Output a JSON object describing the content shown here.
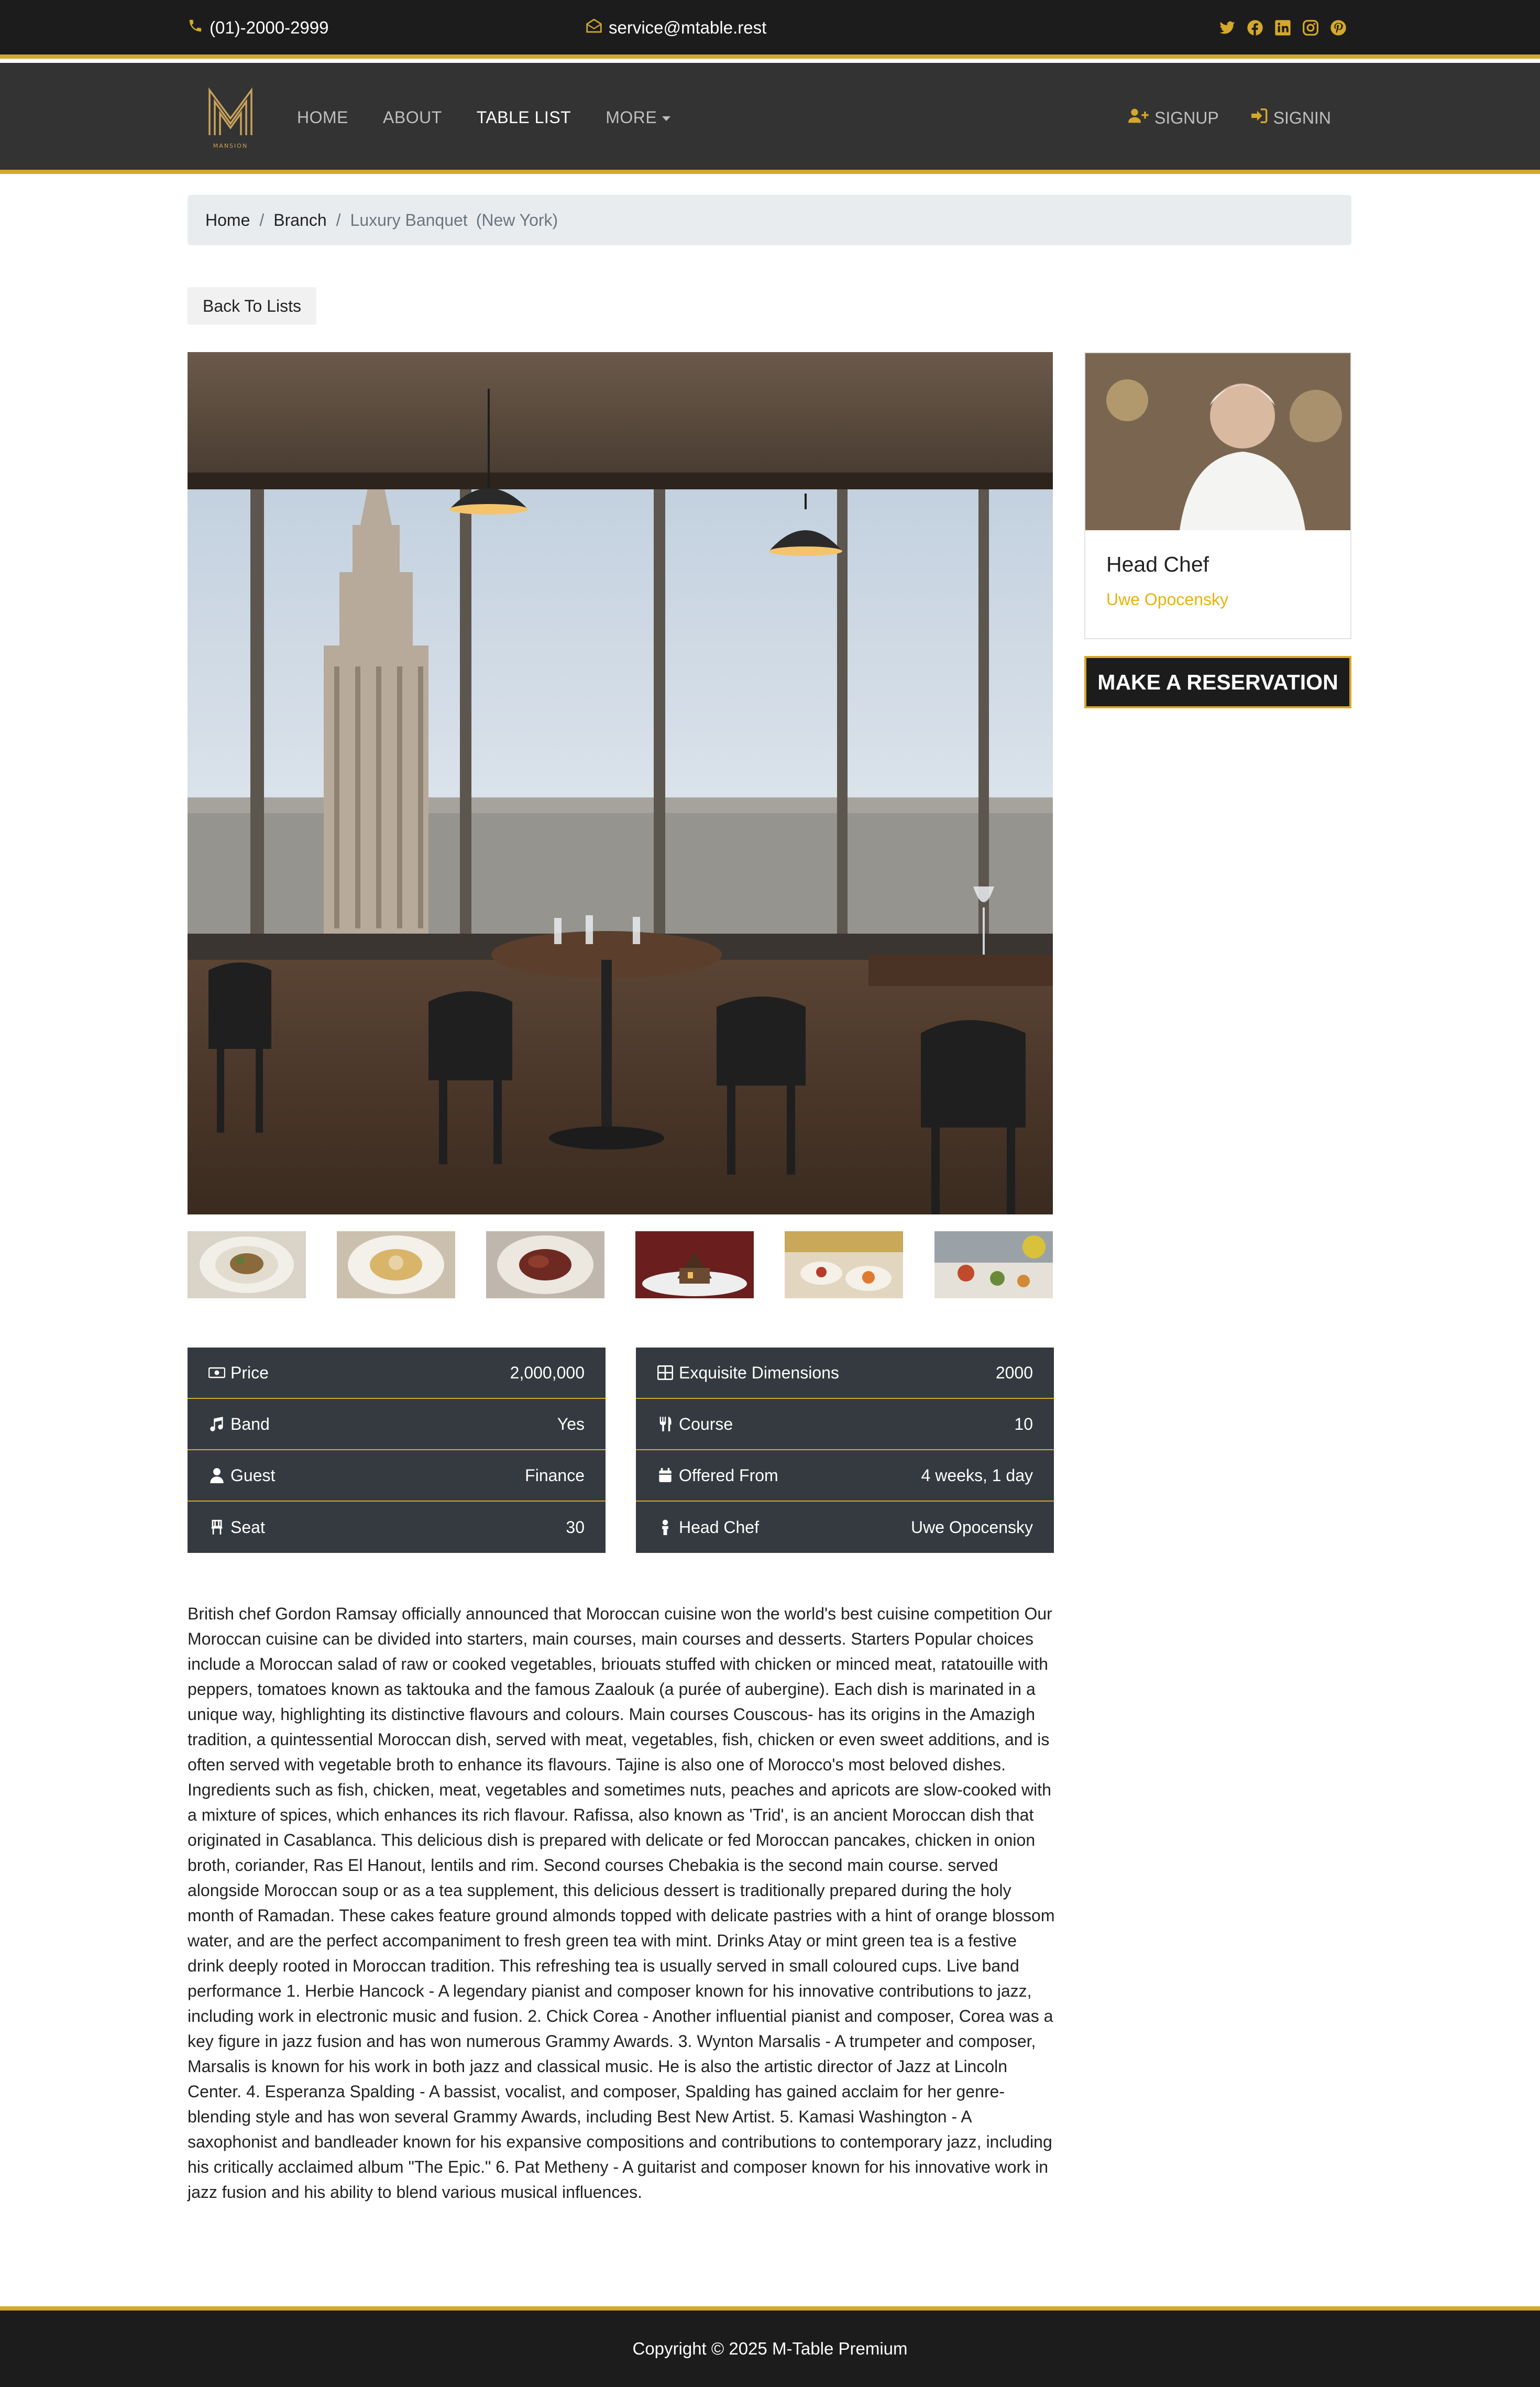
{
  "topbar": {
    "phone": "(01)-2000-2999",
    "email": "service@mtable.rest",
    "social_icons": [
      "twitter-icon",
      "facebook-icon",
      "linkedin-icon",
      "instagram-icon",
      "pinterest-icon"
    ],
    "icon_color": "#d4a82a"
  },
  "nav": {
    "logo_text": "MANSION",
    "items": [
      "HOME",
      "ABOUT",
      "TABLE LIST",
      "MORE"
    ],
    "active": "TABLE LIST",
    "signup": "SIGNUP",
    "signin": "SIGNIN"
  },
  "breadcrumb": {
    "home": "Home",
    "branch": "Branch",
    "current": "Luxury Banquet",
    "location": "(New York)"
  },
  "back_label": "Back To Lists",
  "chef_card": {
    "role": "Head Chef",
    "name": "Uwe Opocensky"
  },
  "reserve_label": "MAKE A RESERVATION",
  "details_left": [
    {
      "icon": "money-icon",
      "label": "Price",
      "value": "2,000,000"
    },
    {
      "icon": "music-icon",
      "label": "Band",
      "value": "Yes"
    },
    {
      "icon": "user-icon",
      "label": "Guest",
      "value": "Finance"
    },
    {
      "icon": "chair-icon",
      "label": "Seat",
      "value": "30"
    }
  ],
  "details_right": [
    {
      "icon": "grid-icon",
      "label": "Exquisite Dimensions",
      "value": "2000"
    },
    {
      "icon": "utensils-icon",
      "label": "Course",
      "value": "10"
    },
    {
      "icon": "calendar-icon",
      "label": "Offered From",
      "value": "4 weeks, 1 day"
    },
    {
      "icon": "chef-icon",
      "label": "Head Chef",
      "value": "Uwe Opocensky"
    }
  ],
  "description": "British chef Gordon Ramsay officially announced that Moroccan cuisine won the world's best cuisine competition Our Moroccan cuisine can be divided into starters, main courses, main courses and desserts. Starters Popular choices include a Moroccan salad of raw or cooked vegetables, briouats stuffed with chicken or minced meat, ratatouille with peppers, tomatoes known as taktouka and the famous Zaalouk (a purée of aubergine). Each dish is marinated in a unique way, highlighting its distinctive flavours and colours.  Main courses Couscous- has its origins in the Amazigh tradition, a quintessential Moroccan dish, served with meat, vegetables, fish, chicken or even sweet additions, and is often served with vegetable broth to enhance its flavours. Tajine is also one of Morocco's most beloved dishes. Ingredients such as fish, chicken, meat, vegetables and sometimes nuts, peaches and apricots are slow-cooked with a mixture of spices, which enhances its rich flavour.  Rafissa, also known as 'Trid', is an ancient Moroccan dish that originated in Casablanca. This delicious dish is prepared with delicate or fed Moroccan pancakes, chicken in onion broth, coriander, Ras El Hanout, lentils and rim.   Second courses Chebakia is the second main course. served alongside Moroccan soup or as a tea supplement, this delicious dessert is traditionally prepared during the holy month of Ramadan. These cakes feature ground almonds topped with delicate pastries with a hint of orange blossom water, and are the perfect accompaniment to fresh green tea with mint.  Drinks Atay or mint green tea is a festive drink deeply rooted in Moroccan tradition. This refreshing tea is usually served in small coloured cups. Live band performance 1. Herbie Hancock - A legendary pianist and composer known for his innovative contributions to jazz, including work in electronic music and fusion. 2. Chick Corea - Another influential pianist and composer, Corea was a key figure in jazz fusion and has won numerous Grammy Awards. 3. Wynton Marsalis - A trumpeter and composer, Marsalis is known for his work in both jazz and classical music. He is also the artistic director of Jazz at Lincoln Center. 4. Esperanza Spalding - A bassist, vocalist, and composer, Spalding has gained acclaim for her genre-blending style and has won several Grammy Awards, including Best New Artist. 5. Kamasi Washington - A saxophonist and bandleader known for his expansive compositions and contributions to contemporary jazz, including his critically acclaimed album \"The Epic.\" 6. Pat Metheny - A guitarist and composer known for his innovative work in jazz fusion and his ability to blend various musical influences.",
  "footer": "Copyright © 2025 M-Table Premium",
  "colors": {
    "accent": "#d4a82a",
    "dark": "#1c1c1c",
    "nav": "#333333",
    "table": "#343a40",
    "chef_name": "#e8b20e"
  }
}
